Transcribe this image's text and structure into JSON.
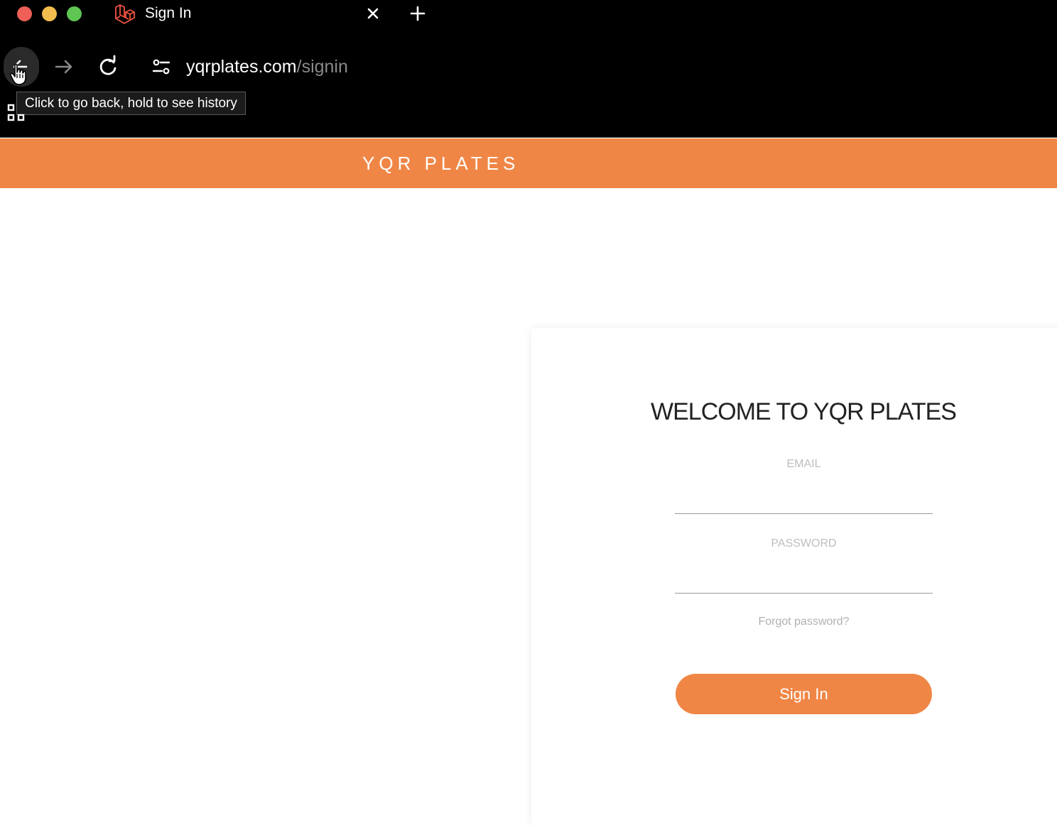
{
  "browser": {
    "tab_title": "Sign In",
    "url_host": "yqrplates.com",
    "url_path": "/signin",
    "back_tooltip": "Click to go back, hold to see history",
    "colors": {
      "chrome_bg": "#000000",
      "traffic_red": "#ee5f57",
      "traffic_yellow": "#f4bd4f",
      "traffic_green": "#5fc553",
      "favicon": "#f05340"
    }
  },
  "site": {
    "brand": "YQR PLATES",
    "accent_color": "#f08646"
  },
  "signin": {
    "heading": "WELCOME TO YQR PLATES",
    "email_label": "EMAIL",
    "email_value": "",
    "password_label": "PASSWORD",
    "password_value": "",
    "forgot_link": "Forgot password?",
    "submit_label": "Sign In"
  },
  "icons": [
    "laravel-favicon-icon",
    "close-icon",
    "plus-icon",
    "back-arrow-icon",
    "forward-arrow-icon",
    "reload-icon",
    "site-settings-icon",
    "apps-grid-icon",
    "hand-cursor-icon"
  ]
}
